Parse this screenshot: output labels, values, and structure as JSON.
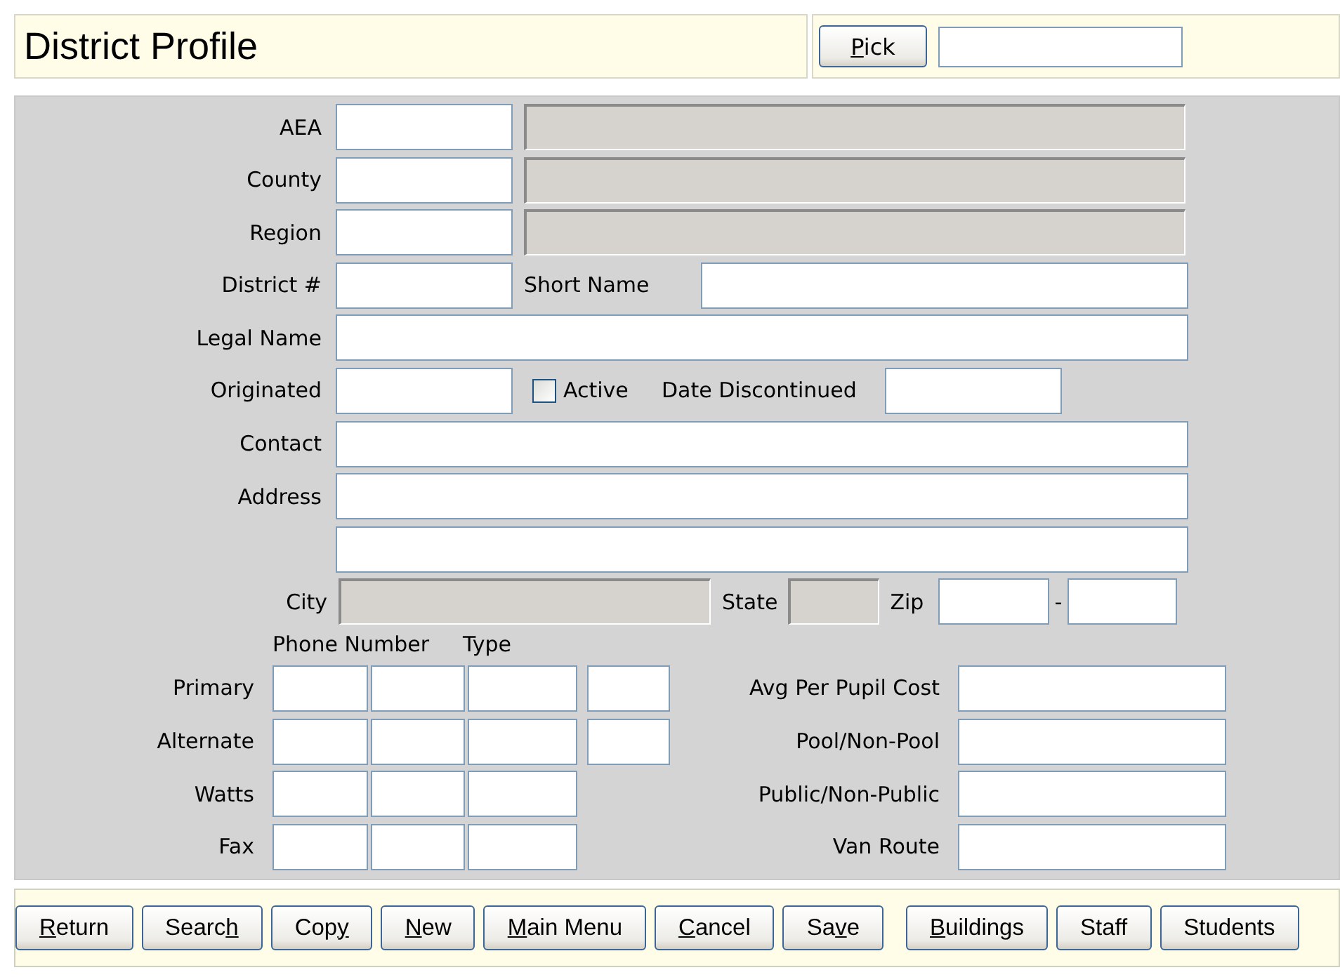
{
  "header": {
    "title": "District Profile",
    "pick_button": {
      "key": "P",
      "after": "ick"
    },
    "pick_field": {
      "disabled": false
    }
  },
  "form": {
    "rows": [
      {
        "kind": "code_desc",
        "label": "AEA",
        "code": {
          "disabled": false
        },
        "description": {
          "disabled": true
        }
      },
      {
        "kind": "code_desc",
        "label": "County",
        "code": {
          "disabled": false
        },
        "description": {
          "disabled": true
        }
      },
      {
        "kind": "code_desc",
        "label": "Region",
        "code": {
          "disabled": false
        },
        "description": {
          "disabled": true
        }
      },
      {
        "kind": "code_named",
        "label": "District #",
        "code": {
          "disabled": false
        },
        "inner_label": "Short Name",
        "field": {
          "disabled": false
        }
      },
      {
        "kind": "wide",
        "label": "Legal Name",
        "field": {
          "disabled": false
        }
      },
      {
        "kind": "dates",
        "label": "Originated",
        "field": {
          "disabled": false
        },
        "checkbox": {
          "label": "Active",
          "checked": false
        },
        "inner_label": "Date Discontinued",
        "end_field": {
          "disabled": false
        }
      },
      {
        "kind": "wide",
        "label": "Contact",
        "field": {
          "disabled": false
        }
      },
      {
        "kind": "wide",
        "label": "Address",
        "field": {
          "disabled": false
        }
      },
      {
        "kind": "wide",
        "field": {
          "disabled": false
        }
      },
      {
        "kind": "city",
        "label": "City",
        "city_field": {
          "disabled": true
        },
        "state_label": "State",
        "state_field": {
          "disabled": true
        },
        "zip_label": "Zip",
        "zip_field": {
          "disabled": false
        },
        "separator": "-",
        "zip4_field": {
          "disabled": false
        }
      }
    ],
    "phone_headers": [
      "Phone Number",
      "Type"
    ],
    "phones": [
      {
        "label": "Primary",
        "kind": "with_type",
        "side_label": "Avg Per Pupil Cost"
      },
      {
        "label": "Alternate",
        "kind": "with_type",
        "side_label": "Pool/Non-Pool"
      },
      {
        "label": "Watts",
        "kind": "plain",
        "side_label": "Public/Non-Public"
      },
      {
        "label": "Fax",
        "kind": "plain",
        "side_label": "Van Route"
      }
    ]
  },
  "button_groups": [
    {
      "buttons": [
        {
          "key": "R",
          "after": "eturn"
        },
        {
          "before": "Searc",
          "key": "h"
        },
        {
          "before": "Cop",
          "key": "y"
        },
        {
          "key": "N",
          "after": "ew"
        },
        {
          "key": "M",
          "after": "ain Menu"
        },
        {
          "key": "C",
          "after": "ancel"
        },
        {
          "before": "Sa",
          "key": "v",
          "after": "e"
        }
      ]
    },
    {
      "buttons": [
        {
          "key": "B",
          "after": "uildings"
        },
        {
          "label": "Staff"
        },
        {
          "label": "Students"
        }
      ]
    }
  ]
}
